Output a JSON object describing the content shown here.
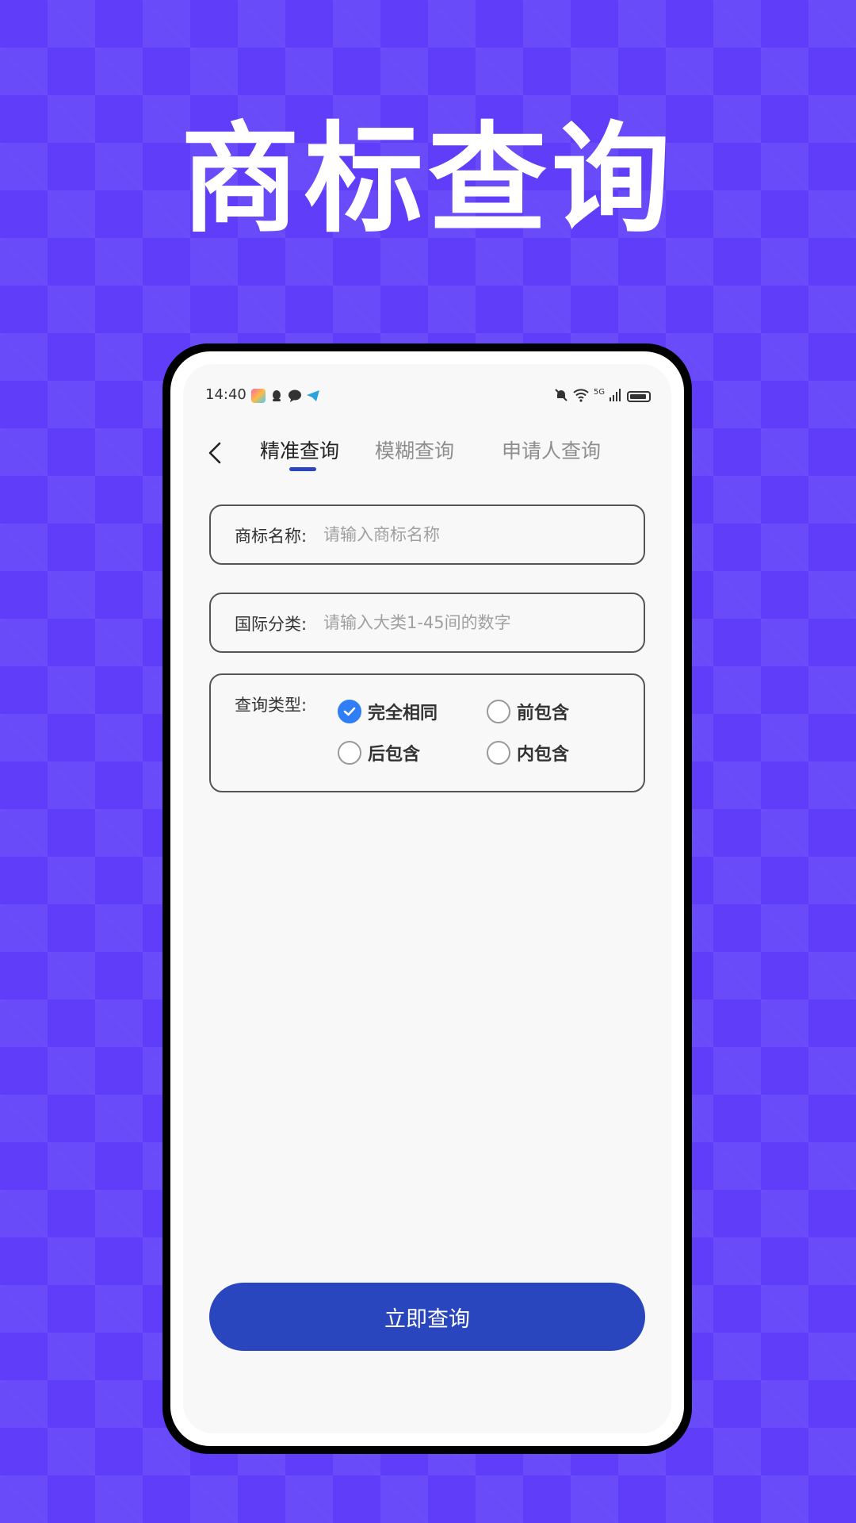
{
  "hero": {
    "title": "商标查询"
  },
  "status_bar": {
    "time": "14:40",
    "network": "5G"
  },
  "nav": {
    "tabs": [
      {
        "label": "精准查询",
        "active": true
      },
      {
        "label": "模糊查询",
        "active": false
      },
      {
        "label": "申请人查询",
        "active": false
      }
    ]
  },
  "form": {
    "trademark_name": {
      "label": "商标名称:",
      "placeholder": "请输入商标名称",
      "value": ""
    },
    "intl_class": {
      "label": "国际分类:",
      "placeholder": "请输入大类1-45间的数字",
      "value": ""
    },
    "query_type": {
      "label": "查询类型:",
      "options": [
        {
          "label": "完全相同",
          "checked": true
        },
        {
          "label": "前包含",
          "checked": false
        },
        {
          "label": "后包含",
          "checked": false
        },
        {
          "label": "内包含",
          "checked": false
        }
      ]
    }
  },
  "submit": {
    "label": "立即查询"
  },
  "colors": {
    "background": "#5f3df9",
    "primary_button": "#2946bf",
    "tab_indicator": "#2b45c0",
    "radio_checked": "#2f7ef5"
  }
}
